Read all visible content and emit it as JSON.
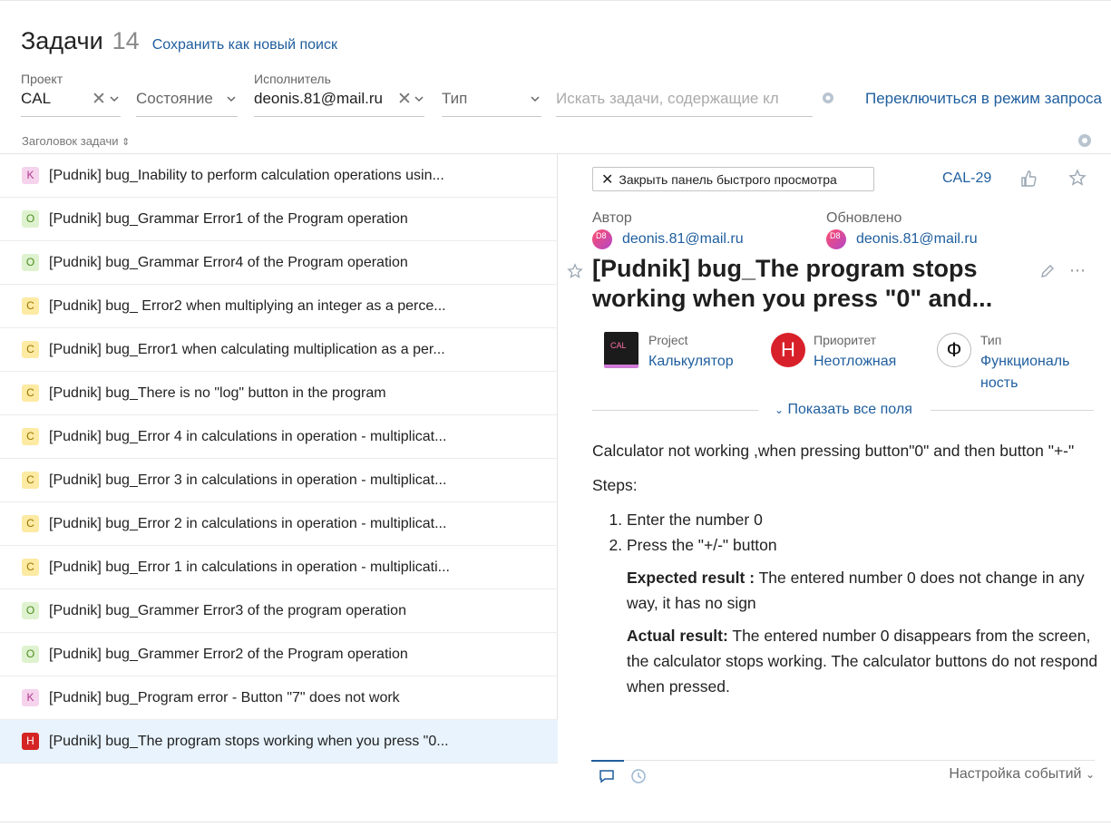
{
  "header": {
    "title": "Задачи",
    "count": "14",
    "save_search": "Сохранить как новый поиск"
  },
  "filters": {
    "project": {
      "label": "Проект",
      "value": "CAL"
    },
    "state": {
      "placeholder": "Состояние"
    },
    "assignee": {
      "label": "Исполнитель",
      "value": "deonis.81@mail.ru"
    },
    "type": {
      "placeholder": "Тип"
    },
    "search": {
      "placeholder": "Искать задачи, содержащие кл"
    },
    "switch_mode": "Переключиться в режим запроса"
  },
  "sort": {
    "label": "Заголовок задачи"
  },
  "issues": [
    {
      "badge": "K",
      "text": "[Pudnik] bug_Inability to perform calculation operations usin..."
    },
    {
      "badge": "O",
      "text": "[Pudnik] bug_Grammar Error1 of the Program operation"
    },
    {
      "badge": "O",
      "text": "[Pudnik] bug_Grammar Error4 of the Program operation"
    },
    {
      "badge": "C",
      "text": "[Pudnik] bug_ Error2 when multiplying an integer as a perce..."
    },
    {
      "badge": "C",
      "text": "[Pudnik] bug_Error1 when calculating multiplication as a per..."
    },
    {
      "badge": "C",
      "text": "[Pudnik] bug_There is no \"log\" button in the program"
    },
    {
      "badge": "C",
      "text": "[Pudnik] bug_Error 4 in calculations in operation - multiplicat..."
    },
    {
      "badge": "C",
      "text": "[Pudnik] bug_Error 3 in calculations in operation - multiplicat..."
    },
    {
      "badge": "C",
      "text": "[Pudnik] bug_Error 2 in calculations in operation - multiplicat..."
    },
    {
      "badge": "C",
      "text": "[Pudnik] bug_Error 1 in calculations in operation - multiplicati..."
    },
    {
      "badge": "O",
      "text": "[Pudnik] bug_Grammer Error3 of the program operation"
    },
    {
      "badge": "O",
      "text": "[Pudnik] bug_Grammer Error2 of the Program operation"
    },
    {
      "badge": "K",
      "text": "[Pudnik] bug_Program error - Button \"7\" does not work"
    },
    {
      "badge": "H",
      "text": "[Pudnik] bug_The program stops working when you press \"0..."
    }
  ],
  "panel": {
    "close_label": "Закрыть панель быстрого просмотра",
    "issue_key": "CAL-29",
    "author_label": "Автор",
    "author": "deonis.81@mail.ru",
    "updated_label": "Обновлено",
    "updated_by": "deonis.81@mail.ru",
    "avatar_text": "D8",
    "title_line1": "[Pudnik] bug_The program stops",
    "title_line2": "working when you press \"0\" and...",
    "fields": {
      "project_label": "Project",
      "project_value": "Калькулятор",
      "project_icon_text": "CAL",
      "priority_label": "Приоритет",
      "priority_value": "Неотложная",
      "priority_icon_text": "Н",
      "type_label": "Тип",
      "type_value_line1": "Функциональ",
      "type_value_line2": "ность",
      "type_icon_text": "Ф"
    },
    "show_all": "Показать все поля",
    "description": {
      "intro": "Calculator not working ,when pressing button\"0\" and then button \"+-\"",
      "steps_label": "Steps:",
      "step1": "Enter the number 0",
      "step2": "Press the \"+/-\" button",
      "expected_label": "Expected result :",
      "expected_text": " The entered number 0 does not change in any way, it has no sign",
      "actual_label": "Actual result:",
      "actual_text": " The entered number 0 disappears from the screen, the calculator stops working. The calculator buttons do not respond when pressed."
    },
    "events_settings": "Настройка событий"
  },
  "colors": {
    "link": "#1f5e9e",
    "selected_row": "#e8f3fd",
    "critical": "#d42424"
  }
}
